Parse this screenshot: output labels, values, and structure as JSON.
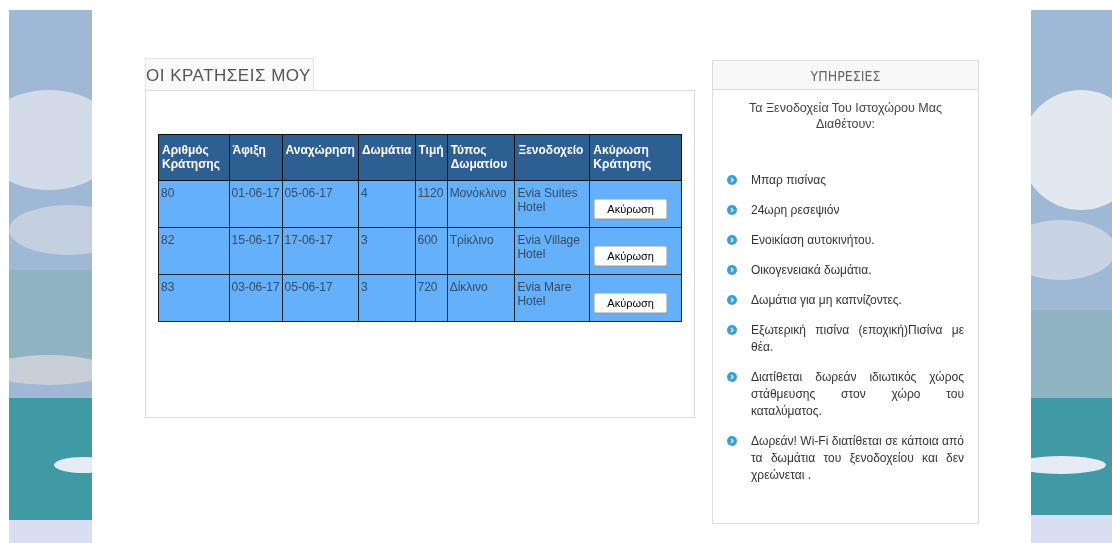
{
  "bookings": {
    "title": "ΟΙ ΚΡΑΤΗΣΕΙΣ ΜΟΥ",
    "columns": [
      "Αριθμός Κράτησης",
      "Άφιξη",
      "Αναχώρηση",
      "Δωμάτια",
      "Τιμή",
      "Τύπος Δωματίου",
      "Ξενοδοχείο",
      "Ακύρωση Κράτησης"
    ],
    "rows": [
      {
        "cells": [
          "80",
          "01-06-17",
          "05-06-17",
          "4",
          "1120",
          "Μονόκλινο",
          "Evia Suites Hotel"
        ],
        "button": "Ακύρωση"
      },
      {
        "cells": [
          "82",
          "15-06-17",
          "17-06-17",
          "3",
          "600",
          "Τρίκλινο",
          "Evia Village Hotel"
        ],
        "button": "Ακύρωση"
      },
      {
        "cells": [
          "83",
          "03-06-17",
          "05-06-17",
          "3",
          "720",
          "Δίκλινο",
          "Evia Mare Hotel"
        ],
        "button": "Ακύρωση"
      }
    ]
  },
  "services": {
    "title": "ΥΠΗΡΕΣΙΕΣ",
    "intro": "Τα Ξενοδοχεία Του Ιστοχώρου Μας Διαθέτουν:",
    "items": [
      "Μπαρ πισίνας",
      "24ωρη ρεσεψιόν",
      "Ενοικίαση αυτοκινήτου.",
      "Οικογενειακά δωμάτια.",
      "Δωμάτια για μη καπνίζοντες.",
      "Εξωτερική πισίνα (εποχική)Πισίνα με θέα.",
      "Διατίθεται δωρεάν ιδιωτικός χώρος στάθμευσης στον χώρο του καταλύματος.",
      "Δωρεάν! Wi-Fi διατίθεται σε κάποια από τα δωμάτια του ξενοδοχείου και δεν χρεώνεται ."
    ]
  }
}
